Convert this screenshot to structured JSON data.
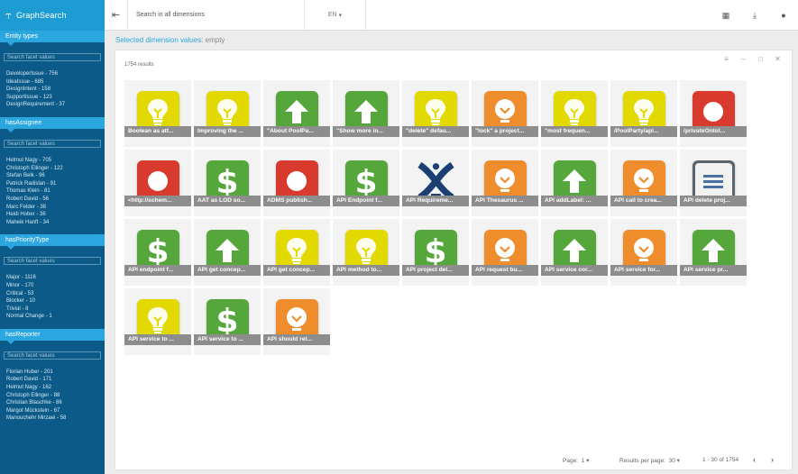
{
  "app": {
    "title": "GraphSearch"
  },
  "topbar": {
    "search_placeholder": "Search in all dimensions",
    "language": "EN"
  },
  "selected": {
    "label": "Selected dimension values:",
    "value": "empty"
  },
  "facets": [
    {
      "title": "Entity types",
      "search_placeholder": "Search facet values",
      "values": [
        "DeveloperIssue - 756",
        "IdeaIssue - 685",
        "DesignIntent - 158",
        "SupportIssue - 123",
        "DesignRequirement - 37"
      ]
    },
    {
      "title": "hasAssignee",
      "search_placeholder": "Search facet values",
      "values": [
        "Helmut Nagy - 705",
        "Christoph Ellinger - 122",
        "Stefan Belk - 96",
        "Patrick Radislan - 91",
        "Thomas Klein - 81",
        "Robert David - 56",
        "Marc Felder - 38",
        "Heidi Hober - 36",
        "Maheik Hanft - 34"
      ]
    },
    {
      "title": "hasPriorityType",
      "search_placeholder": "Search facet values",
      "values": [
        "Major - 1116",
        "Minor - 170",
        "Critical - 53",
        "Blocker - 10",
        "Trivial - 8",
        "Normal Change - 1"
      ]
    },
    {
      "title": "hasReporter",
      "search_placeholder": "Search facet values",
      "values": [
        "Florian Huber - 201",
        "Robert David - 171",
        "Helmut Nagy - 162",
        "Christoph Ellinger - 88",
        "Christian Blaschke - 86",
        "Margot Mückstein - 67",
        "Manouchehr Mirzaei - 58"
      ]
    }
  ],
  "results": {
    "count_label": "1754 results",
    "items": [
      {
        "icon": "bulb",
        "color": "#e2d900",
        "label": "Boolean as att..."
      },
      {
        "icon": "bulb",
        "color": "#e2d900",
        "label": "Improving the ..."
      },
      {
        "icon": "arrow",
        "color": "#56a73b",
        "label": "\"About PoolPa..."
      },
      {
        "icon": "arrow",
        "color": "#56a73b",
        "label": "\"Show more in..."
      },
      {
        "icon": "bulb",
        "color": "#e2d900",
        "label": "\"delete\" defau..."
      },
      {
        "icon": "lightbulb-orange",
        "color": "#ef8d2c",
        "label": "\"lock\" a project..."
      },
      {
        "icon": "bulb",
        "color": "#e2d900",
        "label": "\"most frequen..."
      },
      {
        "icon": "bulb",
        "color": "#e2d900",
        "label": "/PoolParty/api..."
      },
      {
        "icon": "dot",
        "color": "#d93a2e",
        "label": "/privateOntol..."
      },
      {
        "icon": "dot",
        "color": "#d93a2e",
        "label": "<http://schem..."
      },
      {
        "icon": "dollar",
        "color": "#56a73b",
        "label": "AAT as LOD so..."
      },
      {
        "icon": "dot",
        "color": "#d93a2e",
        "label": "ADMS publish..."
      },
      {
        "icon": "dollar",
        "color": "#56a73b",
        "label": "API Endpoint f..."
      },
      {
        "icon": "x-logo",
        "color": "#1b3f73",
        "label": "API Requireme..."
      },
      {
        "icon": "lightbulb-orange",
        "color": "#ef8d2c",
        "label": "API Thesaurus ..."
      },
      {
        "icon": "arrow",
        "color": "#56a73b",
        "label": "API addLabel: ..."
      },
      {
        "icon": "lightbulb-orange",
        "color": "#ef8d2c",
        "label": "API call to crea..."
      },
      {
        "icon": "doc",
        "color": "#5a646c",
        "label": "API delete proj..."
      },
      {
        "icon": "dollar",
        "color": "#56a73b",
        "label": "API endpoint f..."
      },
      {
        "icon": "arrow",
        "color": "#56a73b",
        "label": "API get concep..."
      },
      {
        "icon": "bulb",
        "color": "#e2d900",
        "label": "API get concep..."
      },
      {
        "icon": "bulb",
        "color": "#e2d900",
        "label": "API method to..."
      },
      {
        "icon": "dollar",
        "color": "#56a73b",
        "label": "API project del..."
      },
      {
        "icon": "lightbulb-orange",
        "color": "#ef8d2c",
        "label": "API request bu..."
      },
      {
        "icon": "arrow",
        "color": "#56a73b",
        "label": "API service cor..."
      },
      {
        "icon": "lightbulb-orange",
        "color": "#ef8d2c",
        "label": "API service for..."
      },
      {
        "icon": "arrow",
        "color": "#56a73b",
        "label": "API service pr..."
      },
      {
        "icon": "bulb",
        "color": "#e2d900",
        "label": "API service to ..."
      },
      {
        "icon": "dollar",
        "color": "#56a73b",
        "label": "API service to ..."
      },
      {
        "icon": "lightbulb-orange",
        "color": "#ef8d2c",
        "label": "API should ret..."
      }
    ]
  },
  "pager": {
    "page_label": "Page:",
    "page_value": "1",
    "rpp_label": "Results per page:",
    "rpp_value": "30",
    "range": "1 - 30 of 1754"
  }
}
